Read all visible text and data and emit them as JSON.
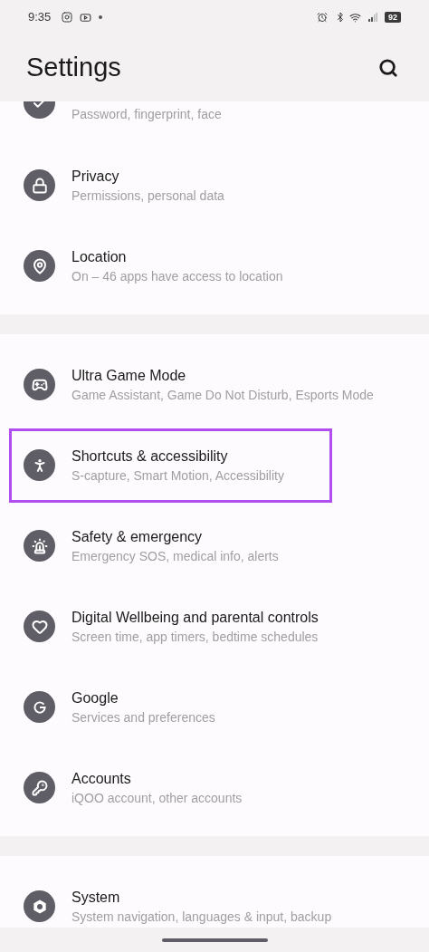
{
  "status_bar": {
    "time": "9:35",
    "battery": "92"
  },
  "header": {
    "title": "Settings"
  },
  "groups": [
    [
      {
        "kind": "check",
        "subtitle": "Password, fingerprint, face",
        "highlighted": false
      },
      {
        "kind": "lock",
        "title": "Privacy",
        "subtitle": "Permissions, personal data",
        "highlighted": false
      },
      {
        "kind": "pin",
        "title": "Location",
        "subtitle": "On – 46 apps have access to location",
        "highlighted": false
      }
    ],
    [
      {
        "kind": "gamepad",
        "title": "Ultra Game Mode",
        "subtitle": "Game Assistant, Game Do Not Disturb, Esports Mode",
        "highlighted": false
      },
      {
        "kind": "accessibility",
        "title": "Shortcuts & accessibility",
        "subtitle": "S-capture, Smart Motion, Accessibility",
        "highlighted": true
      },
      {
        "kind": "siren",
        "title": "Safety & emergency",
        "subtitle": "Emergency SOS, medical info, alerts",
        "highlighted": false
      },
      {
        "kind": "heart",
        "title": "Digital Wellbeing and parental controls",
        "subtitle": "Screen time, app timers, bedtime schedules",
        "highlighted": false
      },
      {
        "kind": "g",
        "title": "Google",
        "subtitle": "Services and preferences",
        "highlighted": false
      },
      {
        "kind": "key",
        "title": "Accounts",
        "subtitle": "iQOO account, other accounts",
        "highlighted": false
      }
    ],
    [
      {
        "kind": "gear",
        "title": "System",
        "subtitle": "System navigation, languages & input, backup",
        "highlighted": false
      }
    ]
  ]
}
